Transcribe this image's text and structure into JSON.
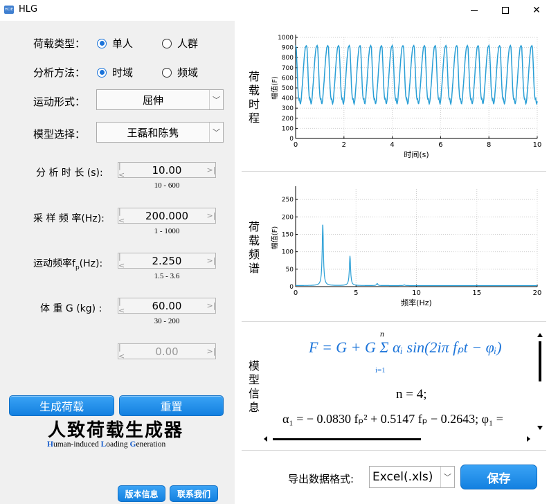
{
  "window": {
    "title": "HLG",
    "icon_text": "HCIE"
  },
  "form": {
    "load_type": {
      "label": "荷载类型：",
      "options": [
        "单人",
        "人群"
      ],
      "selected": "单人"
    },
    "method": {
      "label": "分析方法：",
      "options": [
        "时域",
        "频域"
      ],
      "selected": "时域"
    },
    "motion": {
      "label": "运动形式：",
      "value": "屈伸"
    },
    "model": {
      "label": "模型选择：",
      "value": "王磊和陈隽"
    },
    "duration": {
      "label": "分 析 时 长  (s):",
      "value": "10.00",
      "range": "10 - 600"
    },
    "sample_rate": {
      "label": "采 样 频 率(Hz):",
      "value": "200.000",
      "range": "1 - 1000"
    },
    "motion_freq": {
      "label_prefix": "运动频率f",
      "label_sub": "p",
      "label_suffix": "(Hz):",
      "value": "2.250",
      "range": "1.5 - 3.6"
    },
    "weight": {
      "label": "体  重 G (kg) :",
      "value": "60.00",
      "range": "30 - 200"
    },
    "extra": {
      "value": "0.00"
    }
  },
  "buttons": {
    "generate": "生成荷载",
    "reset": "重置",
    "version": "版本信息",
    "contact": "联系我们",
    "save": "保存"
  },
  "brand": {
    "title": "人致荷载生成器",
    "sub": [
      {
        "t": "H",
        "hl": true
      },
      {
        "t": "uman-induced ",
        "hl": false
      },
      {
        "t": "L",
        "hl": true
      },
      {
        "t": "oading ",
        "hl": false
      },
      {
        "t": "G",
        "hl": true
      },
      {
        "t": "eneration",
        "hl": false
      }
    ]
  },
  "sections": {
    "time_history": "荷载时程",
    "spectrum": "荷载频谱",
    "model_info": "模型信息"
  },
  "formula": {
    "main": "F = G + G Σ αᵢ sin(2iπ fₚt − φᵢ)",
    "sum_top": "n",
    "sum_bottom": "i=1",
    "n_line": "n = 4;",
    "alpha_line": "α₁ = − 0.0830 fₚ² + 0.5147 fₚ − 0.2643;  φ₁ ="
  },
  "export": {
    "label": "导出数据格式:",
    "value": "Excel(.xls)"
  },
  "colors": {
    "accent": "#1a73d9",
    "line": "#2a9fd6"
  },
  "chart_data": [
    {
      "type": "line",
      "xlabel": "时间(s)",
      "ylabel": "幅值(F)",
      "xlim": [
        0,
        10
      ],
      "ylim": [
        0,
        1000
      ],
      "xticks": [
        0,
        2,
        4,
        6,
        8,
        10
      ],
      "yticks": [
        0,
        100,
        200,
        300,
        400,
        500,
        600,
        700,
        800,
        900,
        1000
      ],
      "grid": true,
      "frequency": 2.25,
      "cycle_shape": [
        [
          0.0,
          920
        ],
        [
          0.06,
          900
        ],
        [
          0.14,
          700
        ],
        [
          0.2,
          520
        ],
        [
          0.26,
          420
        ],
        [
          0.32,
          380
        ],
        [
          0.36,
          400
        ],
        [
          0.4,
          360
        ],
        [
          0.45,
          340
        ],
        [
          0.52,
          380
        ],
        [
          0.58,
          470
        ],
        [
          0.65,
          560
        ],
        [
          0.72,
          680
        ],
        [
          0.8,
          800
        ],
        [
          0.9,
          900
        ],
        [
          1.0,
          920
        ]
      ]
    },
    {
      "type": "line",
      "xlabel": "频率(Hz)",
      "ylabel": "幅值(F)",
      "xlim": [
        0,
        20
      ],
      "ylim": [
        0,
        280
      ],
      "xticks": [
        0,
        5,
        10,
        15,
        20
      ],
      "yticks": [
        0,
        50,
        100,
        150,
        200,
        250
      ],
      "grid": true,
      "peaks": [
        [
          2.25,
          178
        ],
        [
          4.5,
          85
        ],
        [
          6.75,
          6
        ],
        [
          9.0,
          2
        ]
      ],
      "baseline": 3
    }
  ]
}
